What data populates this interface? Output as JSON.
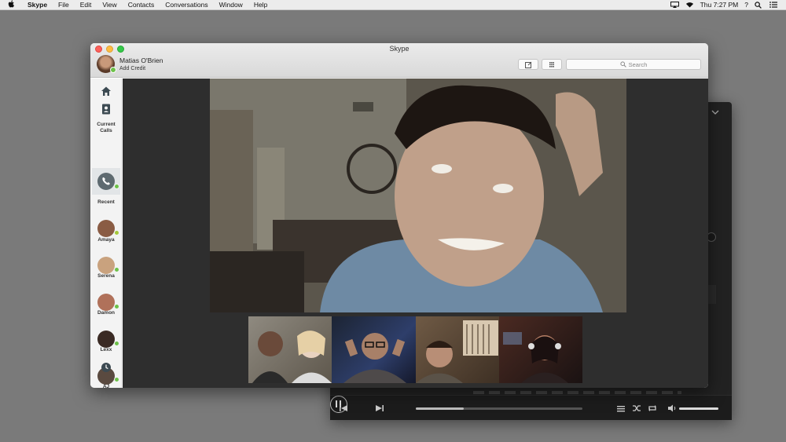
{
  "menubar": {
    "app_name": "Skype",
    "items": [
      "File",
      "Edit",
      "View",
      "Contacts",
      "Conversations",
      "Window",
      "Help"
    ],
    "clock": "Thu 7:27 PM",
    "help_glyph": "?",
    "icons": [
      "apple-icon",
      "airplay-icon",
      "wifi-icon",
      "user-switch-icon",
      "spotlight-search-icon",
      "notification-center-icon"
    ]
  },
  "skype": {
    "window_title": "Skype",
    "profile": {
      "name": "Matias O'Brien",
      "credit_link": "Add Credit",
      "status": "online"
    },
    "search": {
      "placeholder": "Search"
    },
    "toolbar_icons": [
      "compose-icon",
      "dialpad-icon"
    ],
    "sidebar": {
      "current_calls_label": "Current Calls",
      "recent_label": "Recent",
      "contacts": [
        {
          "name": "Amaya",
          "status": "online",
          "color": "#8a5c44"
        },
        {
          "name": "Serena",
          "status": "online",
          "color": "#c9a27e"
        },
        {
          "name": "Damon",
          "status": "online",
          "color": "#b0715a"
        },
        {
          "name": "Lexx",
          "status": "online",
          "color": "#3a2a24"
        },
        {
          "name": "AJ",
          "status": "online",
          "color": "#5a4a40"
        }
      ]
    },
    "call": {
      "main_participant": "video-feed",
      "thumbnails": [
        "participant-video-1",
        "participant-video-2",
        "participant-video-3",
        "participant-video-4"
      ]
    }
  },
  "player": {
    "progress_fraction": 0.29,
    "volume_fraction": 1.0
  },
  "colors": {
    "desktop": "#7a7a7a",
    "presence_online": "#6dc14a",
    "call_background": "#2e2e2e"
  }
}
